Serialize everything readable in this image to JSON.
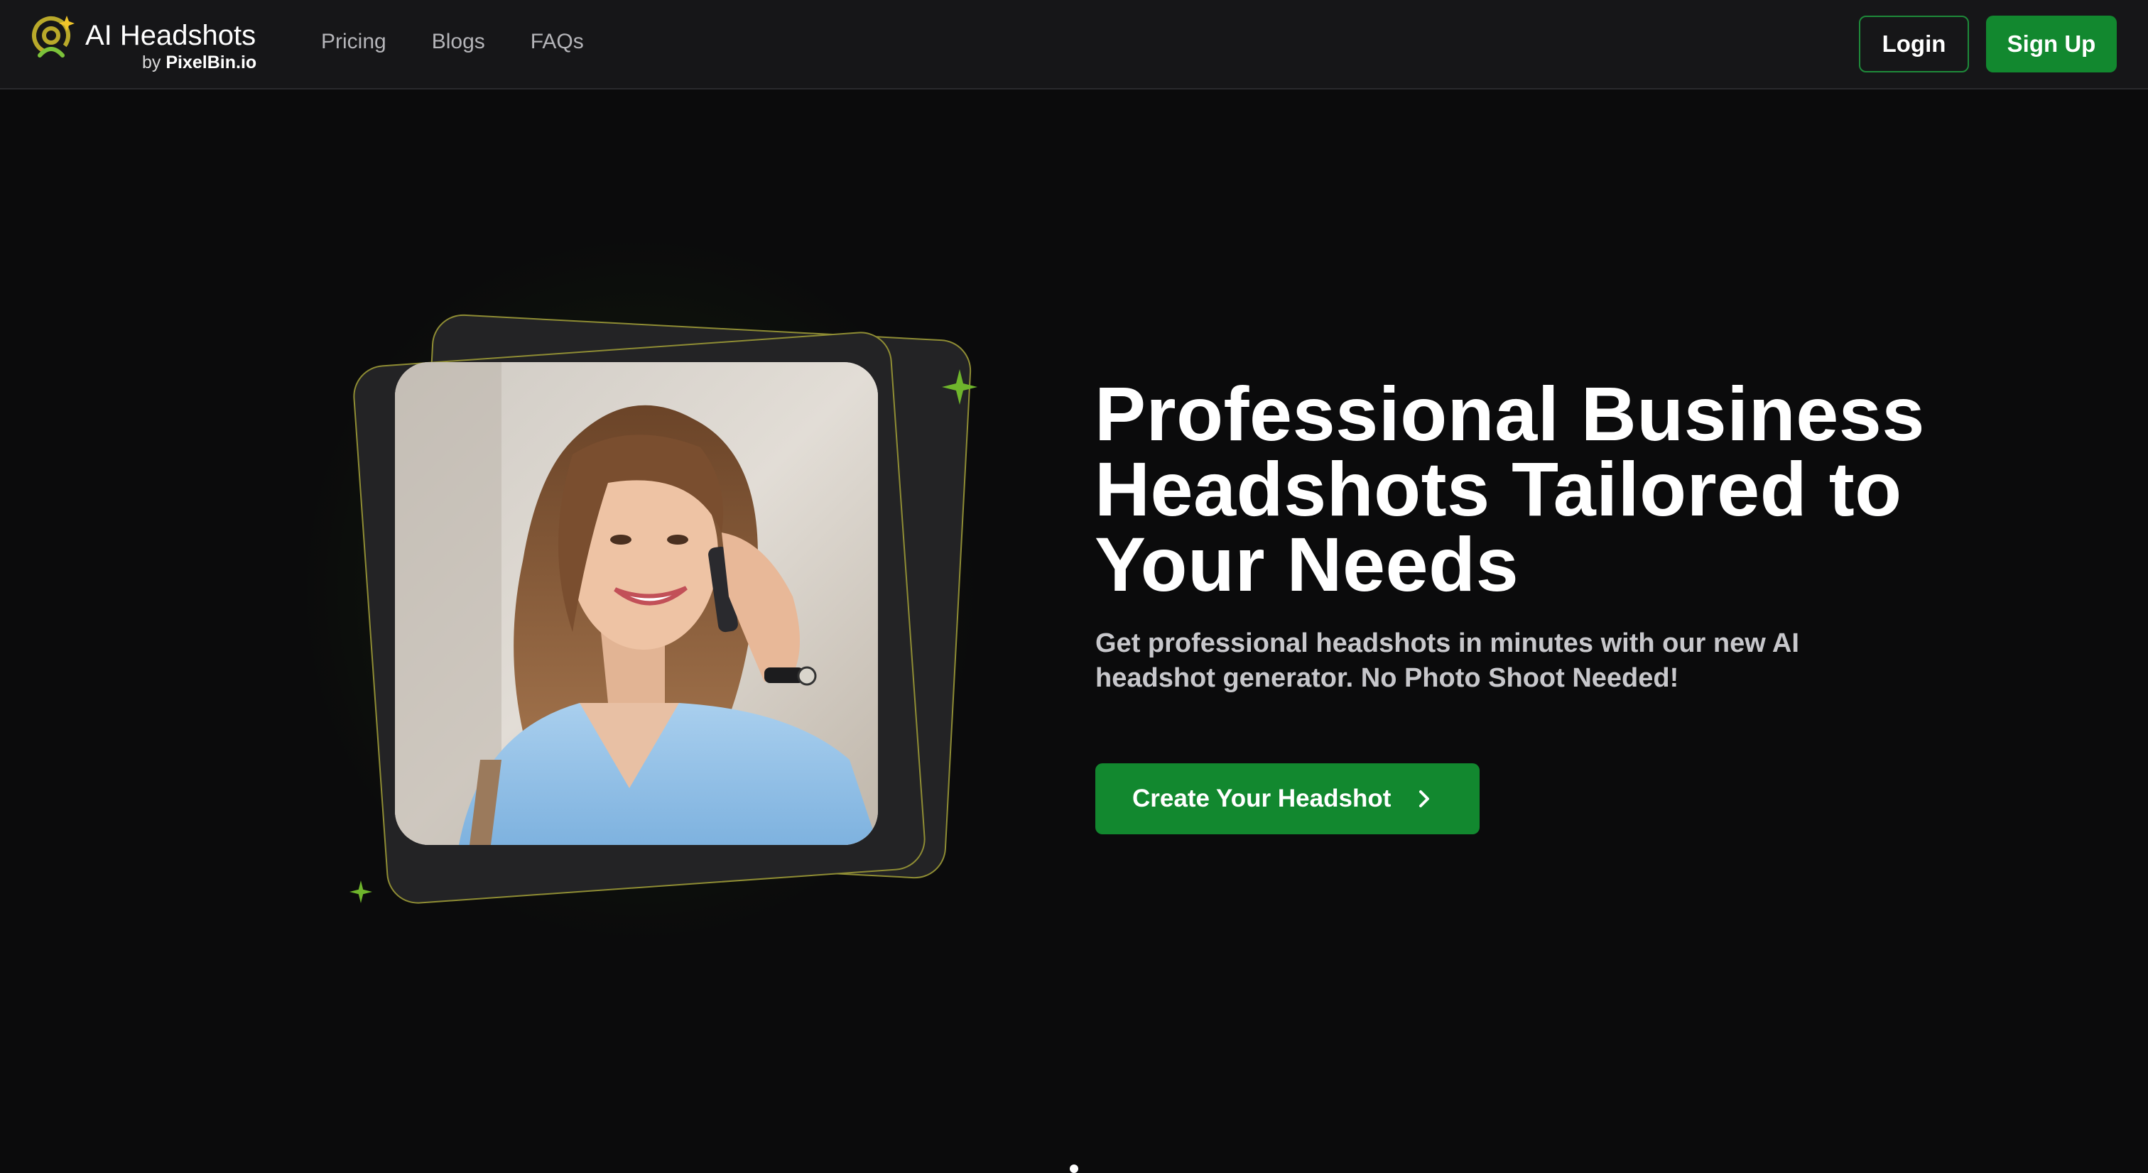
{
  "header": {
    "brand_name": "AI Headshots",
    "brand_by": "by",
    "brand_company": "PixelBin.io",
    "nav": [
      "Pricing",
      "Blogs",
      "FAQs"
    ],
    "login_label": "Login",
    "signup_label": "Sign Up"
  },
  "hero": {
    "title": "Professional Business Headshots Tailored to Your Needs",
    "subtitle": "Get professional headshots in minutes with our new AI headshot generator. No Photo Shoot Needed!",
    "cta_label": "Create Your Headshot",
    "image_description": "smiling woman with long brown hair talking on phone"
  },
  "icons": {
    "logo": "headshot-logo-icon",
    "sparkle": "sparkle-icon",
    "arrow": "chevron-right-icon"
  },
  "colors": {
    "background": "#0b0b0c",
    "header_bg": "#161618",
    "accent_green": "#12882f",
    "card_border": "#8f8d34",
    "sparkle_green": "#6fb52c"
  }
}
